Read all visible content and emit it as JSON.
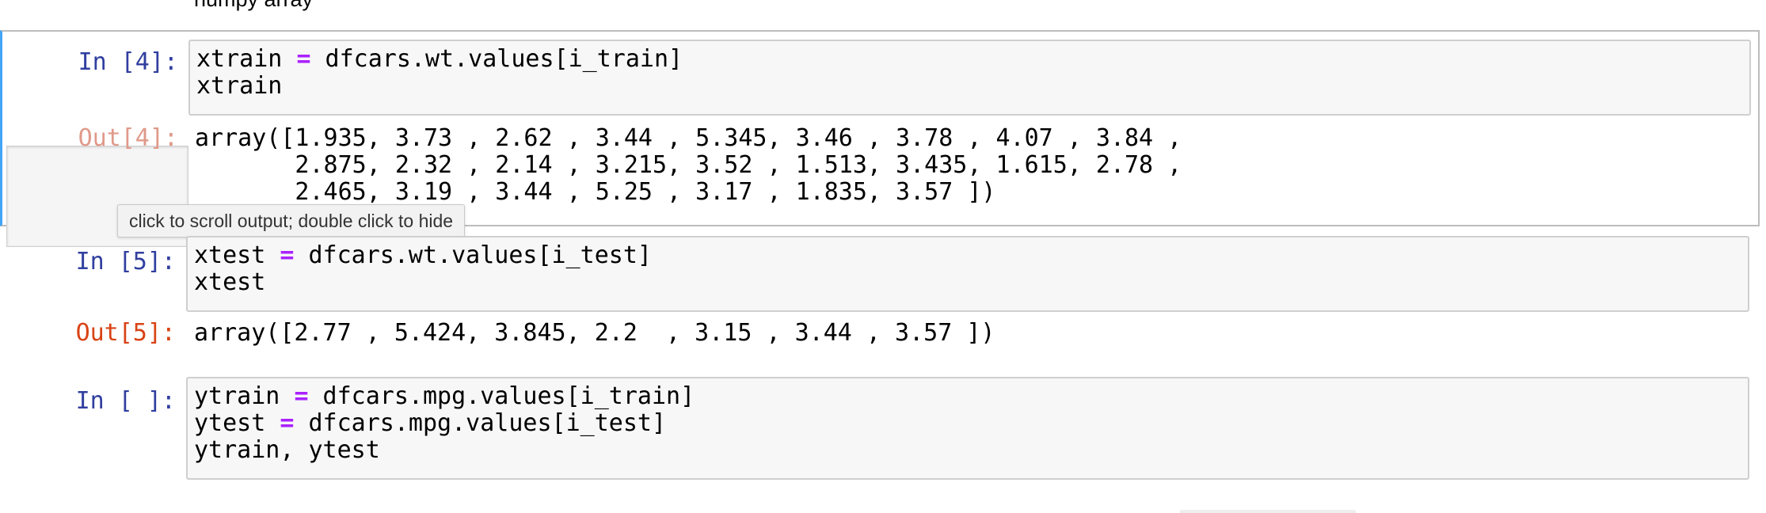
{
  "top_partial_text": "numpy array",
  "cells": [
    {
      "in_prompt": "In [4]:",
      "code_lines": [
        [
          {
            "t": "xtrain "
          },
          {
            "t": "=",
            "op": true
          },
          {
            "t": " dfcars.wt.values[i_train]"
          }
        ],
        [
          {
            "t": "xtrain"
          }
        ]
      ],
      "out_prompt": "Out[4]:",
      "output_lines": [
        "array([1.935, 3.73 , 2.62 , 3.44 , 5.345, 3.46 , 3.78 , 4.07 , 3.84 ,",
        "       2.875, 2.32 , 2.14 , 3.215, 3.52 , 1.513, 3.435, 1.615, 2.78 ,",
        "       2.465, 3.19 , 3.44 , 5.25 , 3.17 , 1.835, 3.57 ])"
      ]
    },
    {
      "in_prompt": "In [5]:",
      "code_lines": [
        [
          {
            "t": "xtest "
          },
          {
            "t": "=",
            "op": true
          },
          {
            "t": " dfcars.wt.values[i_test]"
          }
        ],
        [
          {
            "t": "xtest"
          }
        ]
      ],
      "out_prompt": "Out[5]:",
      "output_lines": [
        "array([2.77 , 5.424, 3.845, 2.2  , 3.15 , 3.44 , 3.57 ])"
      ]
    },
    {
      "in_prompt": "In [ ]:",
      "code_lines": [
        [
          {
            "t": "ytrain "
          },
          {
            "t": "=",
            "op": true
          },
          {
            "t": " dfcars.mpg.values[i_train]"
          }
        ],
        [
          {
            "t": "ytest "
          },
          {
            "t": "=",
            "op": true
          },
          {
            "t": " dfcars.mpg.values[i_test]"
          }
        ],
        [
          {
            "t": "ytrain, ytest"
          }
        ]
      ]
    }
  ],
  "tooltip": "click to scroll output; double click to hide",
  "colors": {
    "in_prompt": "#303f9f",
    "out_prompt": "#d84315",
    "operator": "#aa22ff",
    "selected_cell_bar": "#42a5f5"
  }
}
